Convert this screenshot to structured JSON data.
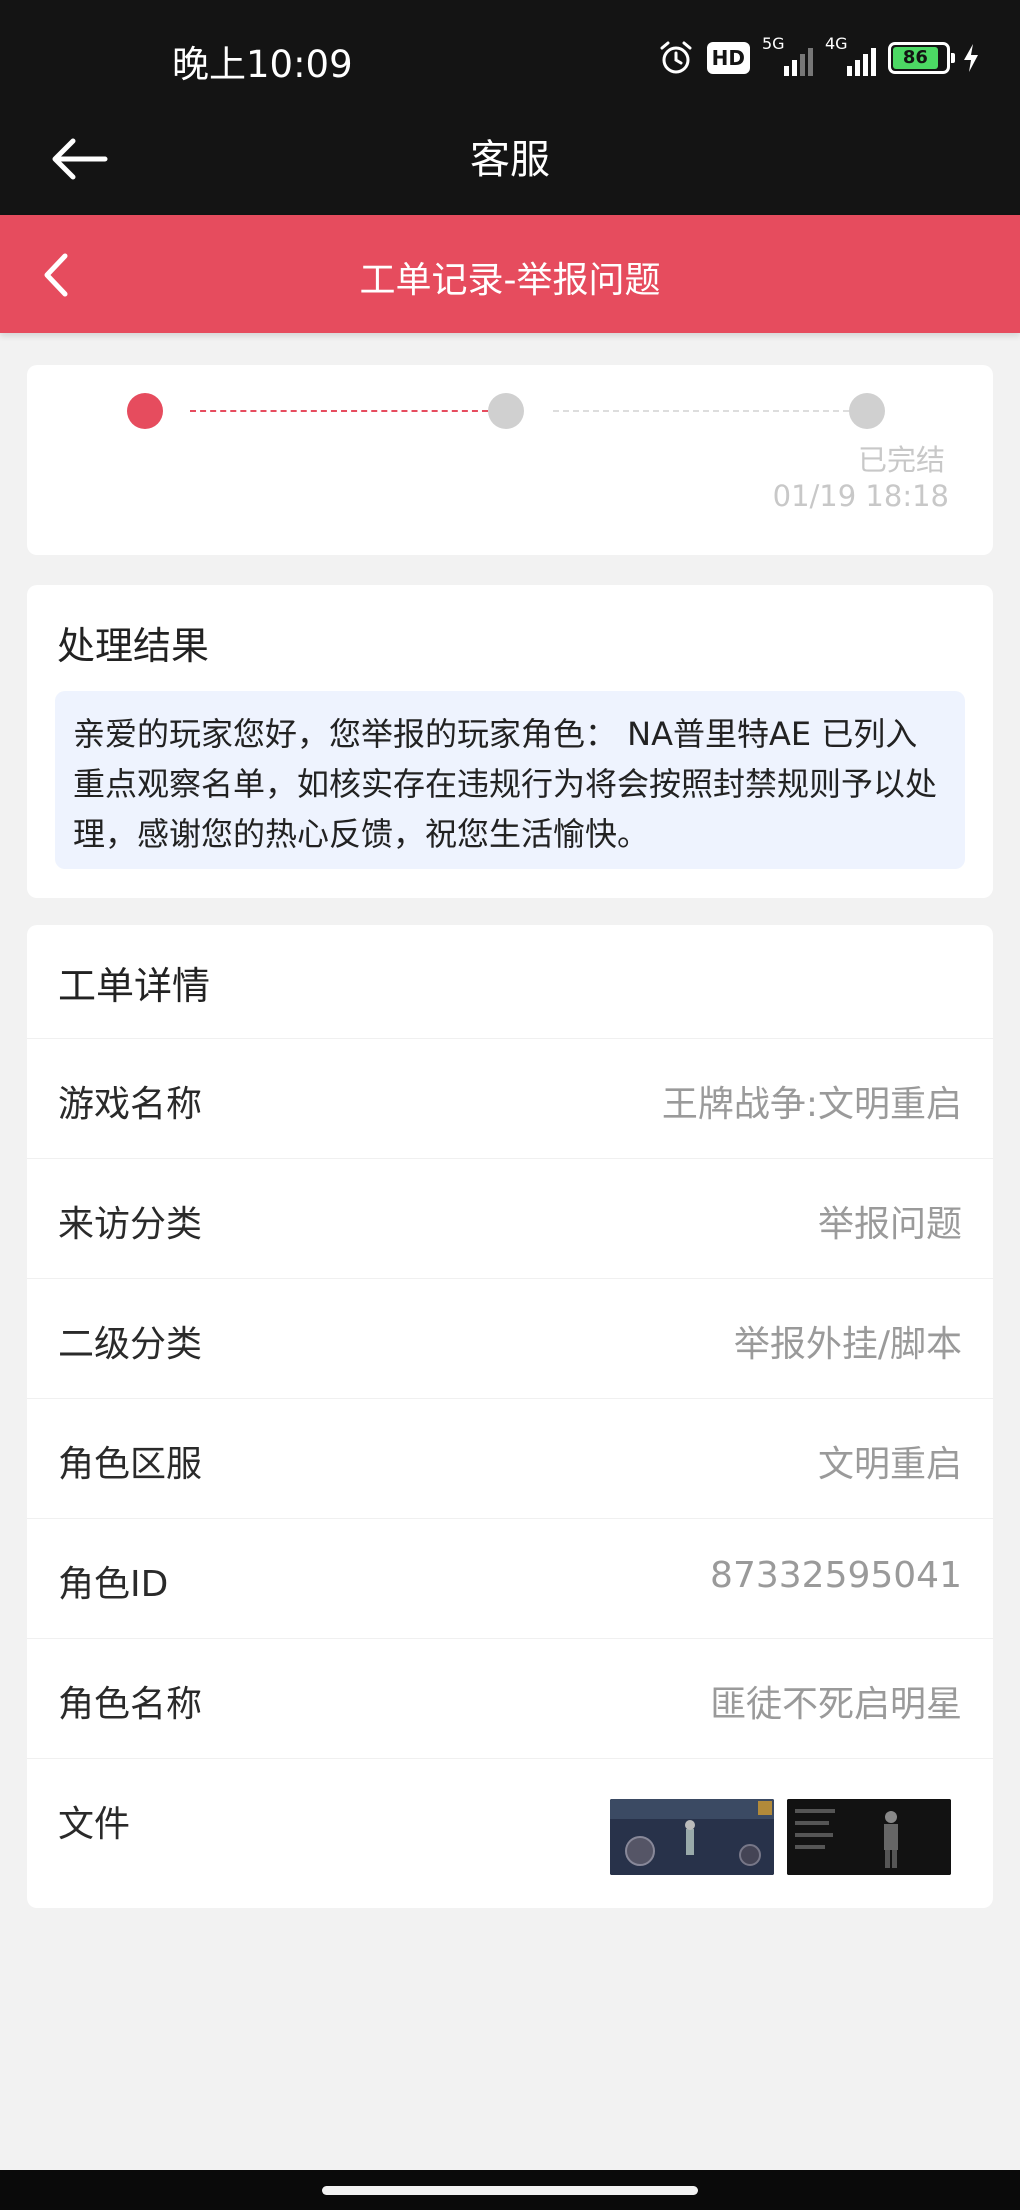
{
  "status_bar": {
    "time": "晚上10:09",
    "hd_label": "HD",
    "network_1": "5G",
    "network_2": "4G",
    "battery_percent": "86",
    "battery_level": 0.86
  },
  "header": {
    "title": "客服",
    "back_icon": "arrow-left-icon"
  },
  "nav": {
    "title": "工单记录-举报问题",
    "back_icon": "chevron-left-icon",
    "color": "#e64c5e"
  },
  "progress": {
    "steps_total": 3,
    "current_step": 1,
    "status_label": "已完结",
    "timestamp": "01/19 18:18",
    "active_color": "#e64c5e",
    "inactive_color": "#d0d0d0"
  },
  "result": {
    "title": "处理结果",
    "message": "亲爱的玩家您好，您举报的玩家角色： NA普里特AE 已列入重点观察名单，如核实存在违规行为将会按照封禁规则予以处理，感谢您的热心反馈，祝您生活愉快。"
  },
  "details": {
    "title": "工单详情",
    "rows": [
      {
        "label": "游戏名称",
        "value": "王牌战争:文明重启"
      },
      {
        "label": "来访分类",
        "value": "举报问题"
      },
      {
        "label": "二级分类",
        "value": "举报外挂/脚本"
      },
      {
        "label": "角色区服",
        "value": "文明重启"
      },
      {
        "label": "角色ID",
        "value": "87332595041"
      },
      {
        "label": "角色名称",
        "value": "匪徒不死启明星"
      }
    ],
    "file_label": "文件"
  }
}
